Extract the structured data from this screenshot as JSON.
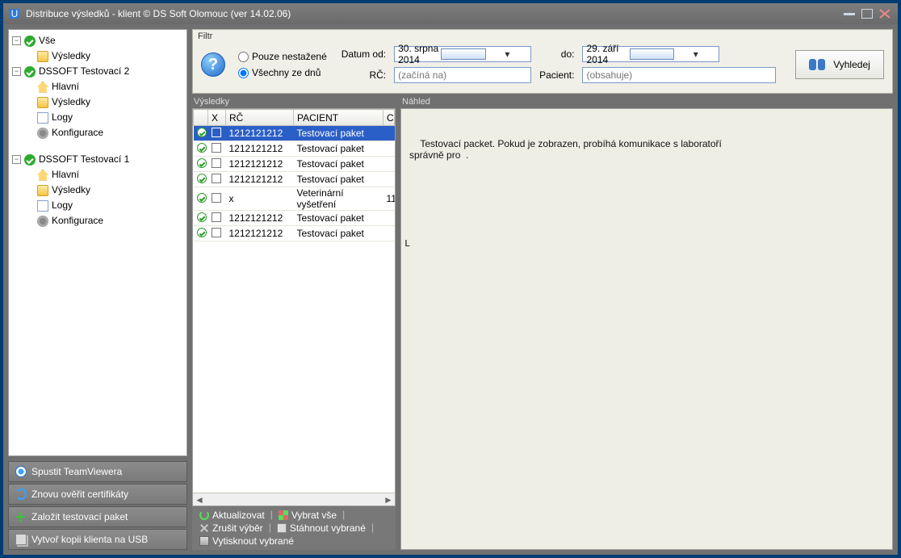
{
  "window": {
    "title": "Distribuce výsledků - klient © DS Soft Olomouc (ver 14.02.06)"
  },
  "tree": {
    "root": {
      "label": "Vše",
      "children": [
        {
          "label": "Výsledky",
          "icon": "folder"
        }
      ]
    },
    "group1": {
      "label": "DSSOFT Testovací 2",
      "children": [
        {
          "label": "Hlavní",
          "icon": "home"
        },
        {
          "label": "Výsledky",
          "icon": "folder"
        },
        {
          "label": "Logy",
          "icon": "page"
        },
        {
          "label": "Konfigurace",
          "icon": "gear"
        }
      ]
    },
    "group2": {
      "label": "DSSOFT Testovací 1",
      "children": [
        {
          "label": "Hlavní",
          "icon": "home"
        },
        {
          "label": "Výsledky",
          "icon": "folder"
        },
        {
          "label": "Logy",
          "icon": "page"
        },
        {
          "label": "Konfigurace",
          "icon": "gear"
        }
      ]
    }
  },
  "sidebar_actions": {
    "teamviewer": "Spustit TeamViewera",
    "recert": "Znovu ověřit certifikáty",
    "testpkt": "Založit testovací paket",
    "usbcopy": "Vytvoř kopii klienta na USB"
  },
  "filter": {
    "title": "Filtr",
    "radio_unread": "Pouze nestažené",
    "radio_all": "Všechny ze dnů",
    "date_from_label": "Datum od:",
    "date_from": "30.   srpna   2014",
    "date_to_label": "do:",
    "date_to": "29.    září    2014",
    "rc_label": "RČ:",
    "rc_placeholder": "(začíná na)",
    "pacient_label": "Pacient:",
    "pacient_placeholder": "(obsahuje)",
    "search_btn": "Vyhledej"
  },
  "results": {
    "title": "Výsledky",
    "cols": {
      "x": "X",
      "rc": "RČ",
      "pacient": "PACIENT",
      "c": "C"
    },
    "rows": [
      {
        "rc": "1212121212",
        "pacient": "Testovací paket",
        "c": "",
        "sel": true
      },
      {
        "rc": "1212121212",
        "pacient": "Testovací paket",
        "c": ""
      },
      {
        "rc": "1212121212",
        "pacient": "Testovací paket",
        "c": ""
      },
      {
        "rc": "1212121212",
        "pacient": "Testovací paket",
        "c": ""
      },
      {
        "rc": "x",
        "pacient": "Veterinární vyšetření",
        "c": "11"
      },
      {
        "rc": "1212121212",
        "pacient": "Testovací paket",
        "c": ""
      },
      {
        "rc": "1212121212",
        "pacient": "Testovací paket",
        "c": ""
      }
    ],
    "footer": {
      "update": "Aktualizovat",
      "selectall": "Vybrat vše",
      "cancel": "Zrušit výběr",
      "download": "Stáhnout vybrané",
      "print": "Vytisknout vybrané"
    }
  },
  "preview": {
    "title": "Náhled",
    "text": "    Testovací packet. Pokud je zobrazen, probíhá komunikace s laboratoří\nsprávně pro  .",
    "stray": "L"
  }
}
